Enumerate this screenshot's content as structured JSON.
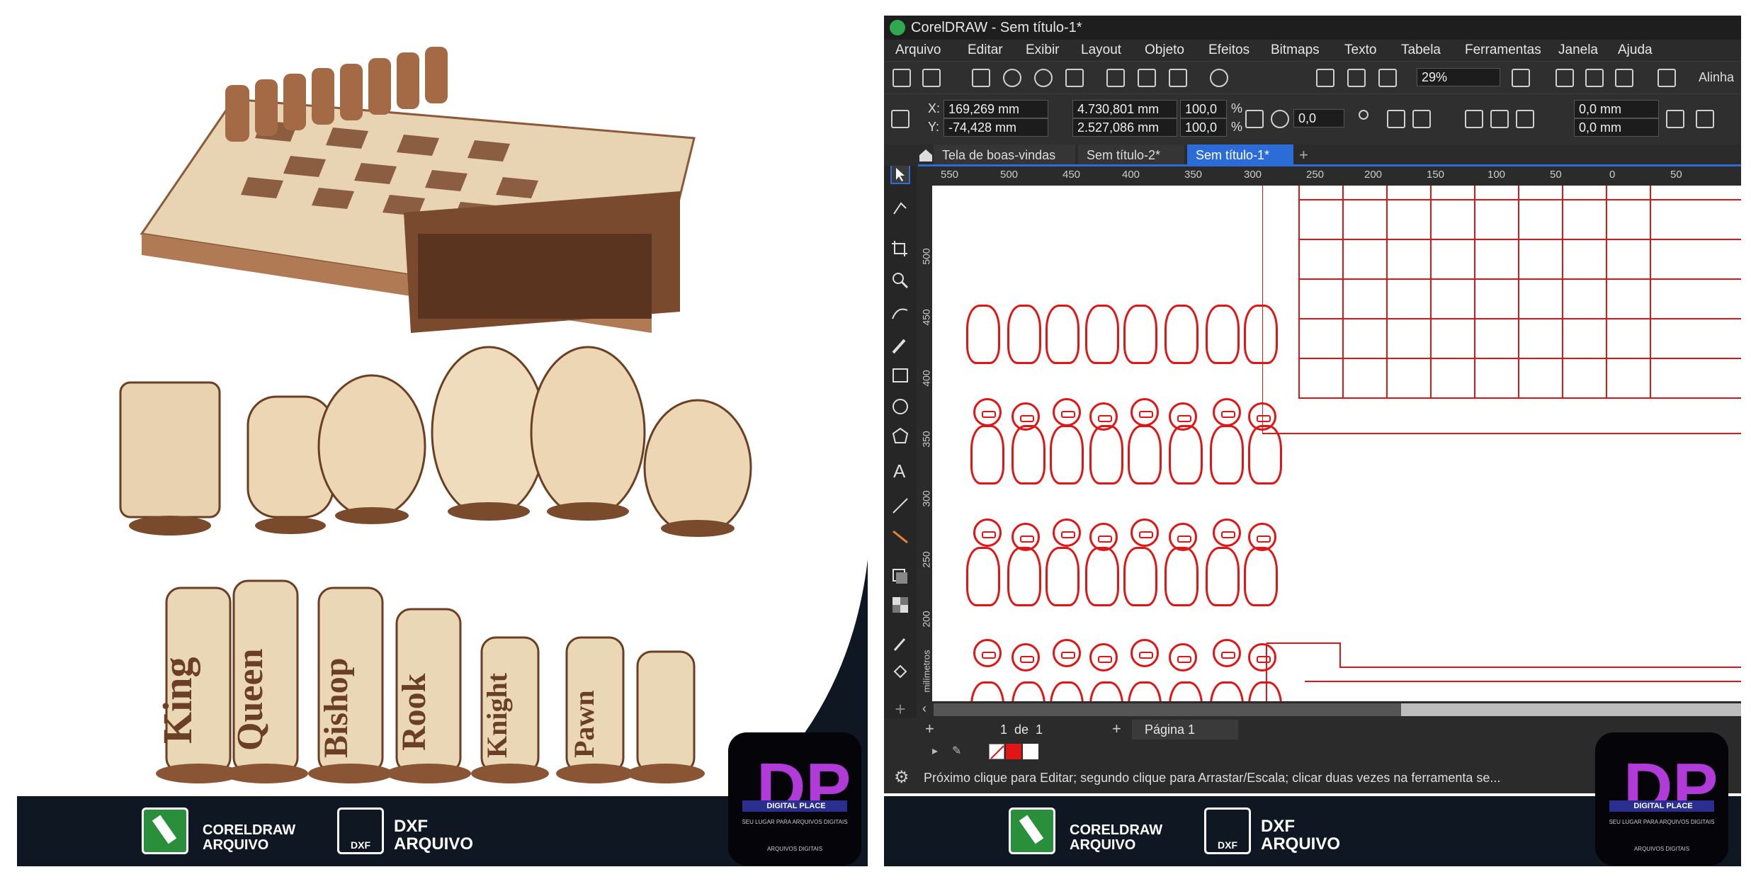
{
  "left_badges": {
    "corel": "CORELDRAW\nARQUIVO",
    "corel_l1": "CORELDRAW",
    "corel_l2": "ARQUIVO",
    "dxf_icon": "DXF",
    "dxf_l1": "DXF",
    "dxf_l2": "ARQUIVO"
  },
  "logo": {
    "brand": "DIGITAL PLACE",
    "tagline": "SEU LUGAR PARA ARQUIVOS DIGITAIS",
    "footer": "ARQUIVOS DIGITAIS"
  },
  "words": {
    "w1": "King",
    "w2": "Queen",
    "w3": "Bishop",
    "w4": "Rook",
    "w5": "Knight",
    "w6": "Pawn"
  },
  "corel": {
    "title": "CorelDRAW - Sem título-1*",
    "menu": [
      "Arquivo",
      "Editar",
      "Exibir",
      "Layout",
      "Objeto",
      "Efeitos",
      "Bitmaps",
      "Texto",
      "Tabela",
      "Ferramentas",
      "Janela",
      "Ajuda"
    ],
    "zoom": "29%",
    "align_label": "Alinha",
    "x_label": "X:",
    "x": "169,269 mm",
    "y_label": "Y:",
    "y": "-74,428 mm",
    "w": "4.730,801 mm",
    "h": "2.527,086 mm",
    "sx": "100,0",
    "sy": "100,0",
    "pct": "%",
    "angle": "0,0",
    "pos1": "0,0 mm",
    "pos2": "0,0 mm",
    "tabs": [
      "Tela de boas-vindas",
      "Sem título-2*",
      "Sem título-1*"
    ],
    "ruler_h": [
      "550",
      "500",
      "450",
      "400",
      "350",
      "300",
      "250",
      "200",
      "150",
      "100",
      "50",
      "0",
      "50"
    ],
    "ruler_v": [
      "500",
      "450",
      "400",
      "350",
      "300",
      "250",
      "200"
    ],
    "units": "milímetros",
    "page_of": "1",
    "page_de": "de",
    "page_total": "1",
    "page_tab": "Página 1",
    "status": "Próximo clique para Editar; segundo clique para Arrastar/Escala; clicar duas vezes na ferramenta se..."
  },
  "colors": {
    "accent": "#2b6cd9",
    "cut_line": "#e01616",
    "banner": "#0f1722"
  }
}
